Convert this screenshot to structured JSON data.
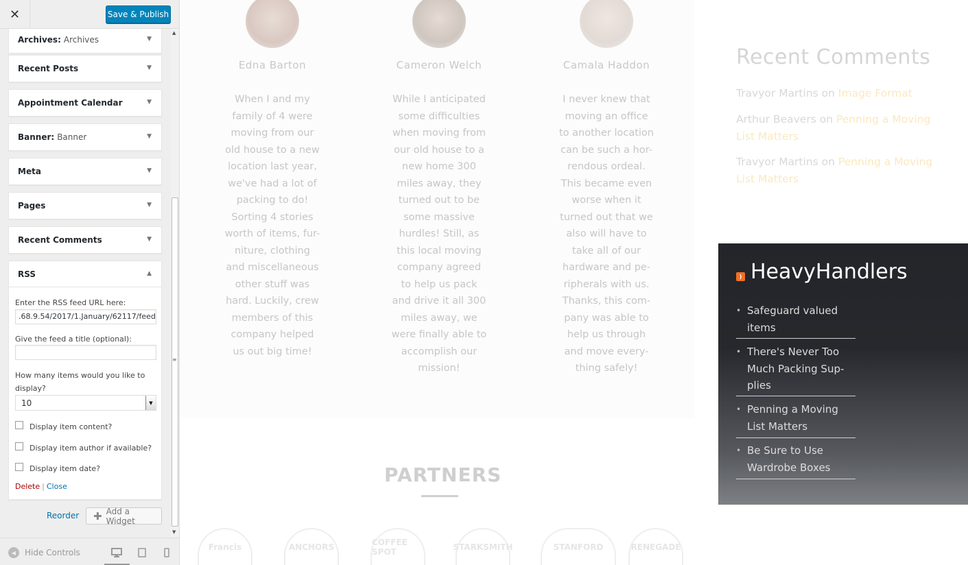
{
  "header": {
    "close_glyph": "✕",
    "publish_label": "Save & Publish"
  },
  "widgets": [
    {
      "title": "Archives:",
      "subtitle": "Archives"
    },
    {
      "title": "Recent Posts",
      "subtitle": ""
    },
    {
      "title": "Appointment Calendar",
      "subtitle": ""
    },
    {
      "title": "Banner:",
      "subtitle": "Banner"
    },
    {
      "title": "Meta",
      "subtitle": ""
    },
    {
      "title": "Pages",
      "subtitle": ""
    },
    {
      "title": "Recent Comments",
      "subtitle": ""
    }
  ],
  "rss_widget": {
    "title": "RSS",
    "url_label": "Enter the RSS feed URL here:",
    "url_value": ".68.9.54/2017/1.January/62117/feed",
    "feed_title_label": "Give the feed a title (optional):",
    "feed_title_value": "",
    "items_label": "How many items would you like to display?",
    "items_value": "10",
    "checkboxes": [
      {
        "label": "Display item content?",
        "checked": false
      },
      {
        "label": "Display item author if available?",
        "checked": false
      },
      {
        "label": "Display item date?",
        "checked": false
      }
    ],
    "delete_label": "Delete",
    "separator": "|",
    "close_label": "Close"
  },
  "actions": {
    "reorder_label": "Reorder",
    "add_widget_label": "Add a Widget"
  },
  "footer": {
    "hide_controls_label": "Hide Controls"
  },
  "preview": {
    "testimonials": [
      {
        "name": "Edna Barton",
        "lines": [
          "When I and my",
          "family of 4 were",
          "moving from our",
          "old house to a new",
          "location last year,",
          "we've had a lot of",
          "packing to do!",
          "Sorting 4 stories",
          "worth of items, fur-",
          "niture, clothing",
          "and miscellaneous",
          "other stuff was",
          "hard. Luckily, crew",
          "members of this",
          "company helped",
          "us out big time!"
        ]
      },
      {
        "name": "Cameron Welch",
        "lines": [
          "While I anticipated",
          "some difficulties",
          "when moving from",
          "our old house to a",
          "new home 300",
          "miles away, they",
          "turned out to be",
          "some massive",
          "hurdles! Still, as",
          "this local moving",
          "company agreed",
          "to help us pack",
          "and drive it all 300",
          "miles away, we",
          "were finally able to",
          "accomplish our",
          "mission!"
        ]
      },
      {
        "name": "Camala Haddon",
        "lines": [
          "I never knew that",
          "moving an office",
          "to another location",
          "can be such a hor-",
          "rendous ordeal.",
          "This became even",
          "worse when it",
          "turned out that we",
          "also will have to",
          "take all of our",
          "hardware and pe-",
          "ripherals with us.",
          "Thanks, this com-",
          "pany was able to",
          "help us through",
          "and move every-",
          "thing safely!"
        ]
      }
    ],
    "partners_title": "PARTNERS",
    "partner_logos": [
      "Francis",
      "ANCHORS",
      "COFFEE SPOT",
      "STARKSMITH",
      "STANFORD",
      "RENEGADE"
    ],
    "recent_comments": {
      "title": "Recent Comments",
      "items": [
        {
          "author": "Travyor Martins",
          "on": "on",
          "post": "Image Format"
        },
        {
          "author": "Arthur Beavers",
          "on": "on",
          "post": "Penning a Moving List Matters"
        },
        {
          "author": "Travyor Martins",
          "on": "on",
          "post": "Penning a Moving List Matters"
        }
      ]
    },
    "rss_feed": {
      "title": "HeavyHandlers",
      "items": [
        "Safeguard valued items",
        "There's Never Too Much Packing Sup- plies",
        "Penning a Moving List Matters",
        "Be Sure to Use Wardrobe Boxes"
      ]
    }
  }
}
